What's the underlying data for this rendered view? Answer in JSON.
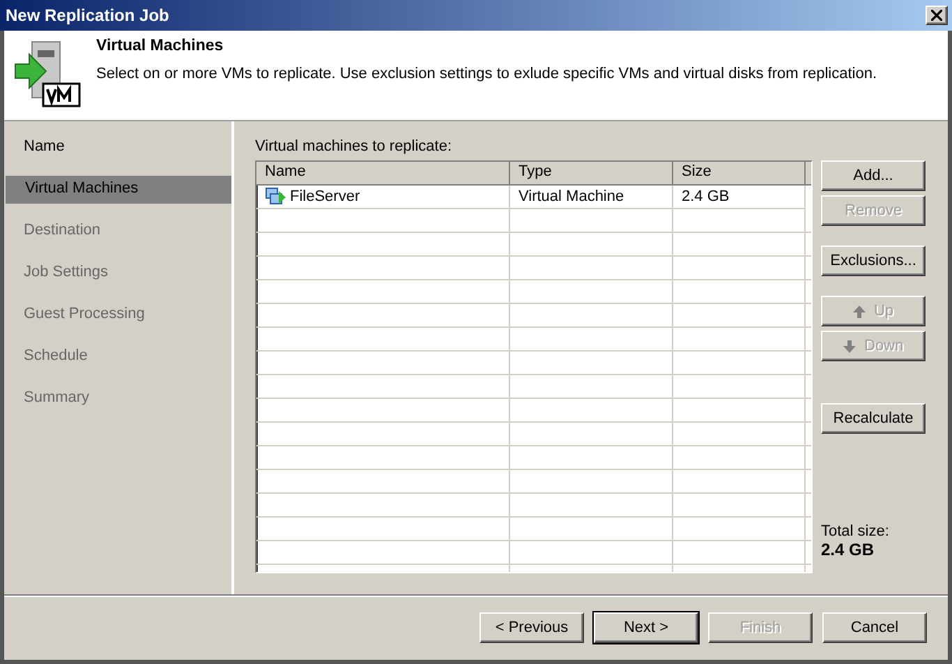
{
  "window": {
    "title": "New Replication Job"
  },
  "header": {
    "title": "Virtual Machines",
    "description": "Select on or more VMs to replicate. Use exclusion settings to exlude specific VMs and virtual disks from replication."
  },
  "steps": [
    {
      "label": "Name",
      "selected": false
    },
    {
      "label": "Virtual Machines",
      "selected": true
    },
    {
      "label": "Destination",
      "selected": false
    },
    {
      "label": "Job Settings",
      "selected": false
    },
    {
      "label": "Guest Processing",
      "selected": false
    },
    {
      "label": "Schedule",
      "selected": false
    },
    {
      "label": "Summary",
      "selected": false
    }
  ],
  "table": {
    "label": "Virtual machines to replicate:",
    "columns": [
      "Name",
      "Type",
      "Size"
    ],
    "rows": [
      {
        "name": "FileServer",
        "type": "Virtual Machine",
        "size": "2.4 GB"
      }
    ]
  },
  "side_buttons": [
    [
      {
        "label": "Add...",
        "disabled": false
      },
      {
        "label": "Remove",
        "disabled": true
      }
    ],
    [
      {
        "label": "Exclusions...",
        "disabled": false
      }
    ],
    [
      {
        "label": "Up",
        "disabled": true
      },
      {
        "label": "Down",
        "disabled": true
      }
    ],
    [
      {
        "label": "Recalculate",
        "disabled": false
      }
    ]
  ],
  "total": {
    "label": "Total size:",
    "value": "2.4 GB"
  },
  "footer_buttons": [
    {
      "label": "< Previous",
      "disabled": false,
      "default": false
    },
    {
      "label": "Next >",
      "disabled": false,
      "default": true
    },
    {
      "label": "Finish",
      "disabled": true,
      "default": false
    },
    {
      "label": "Cancel",
      "disabled": false,
      "default": false
    }
  ]
}
